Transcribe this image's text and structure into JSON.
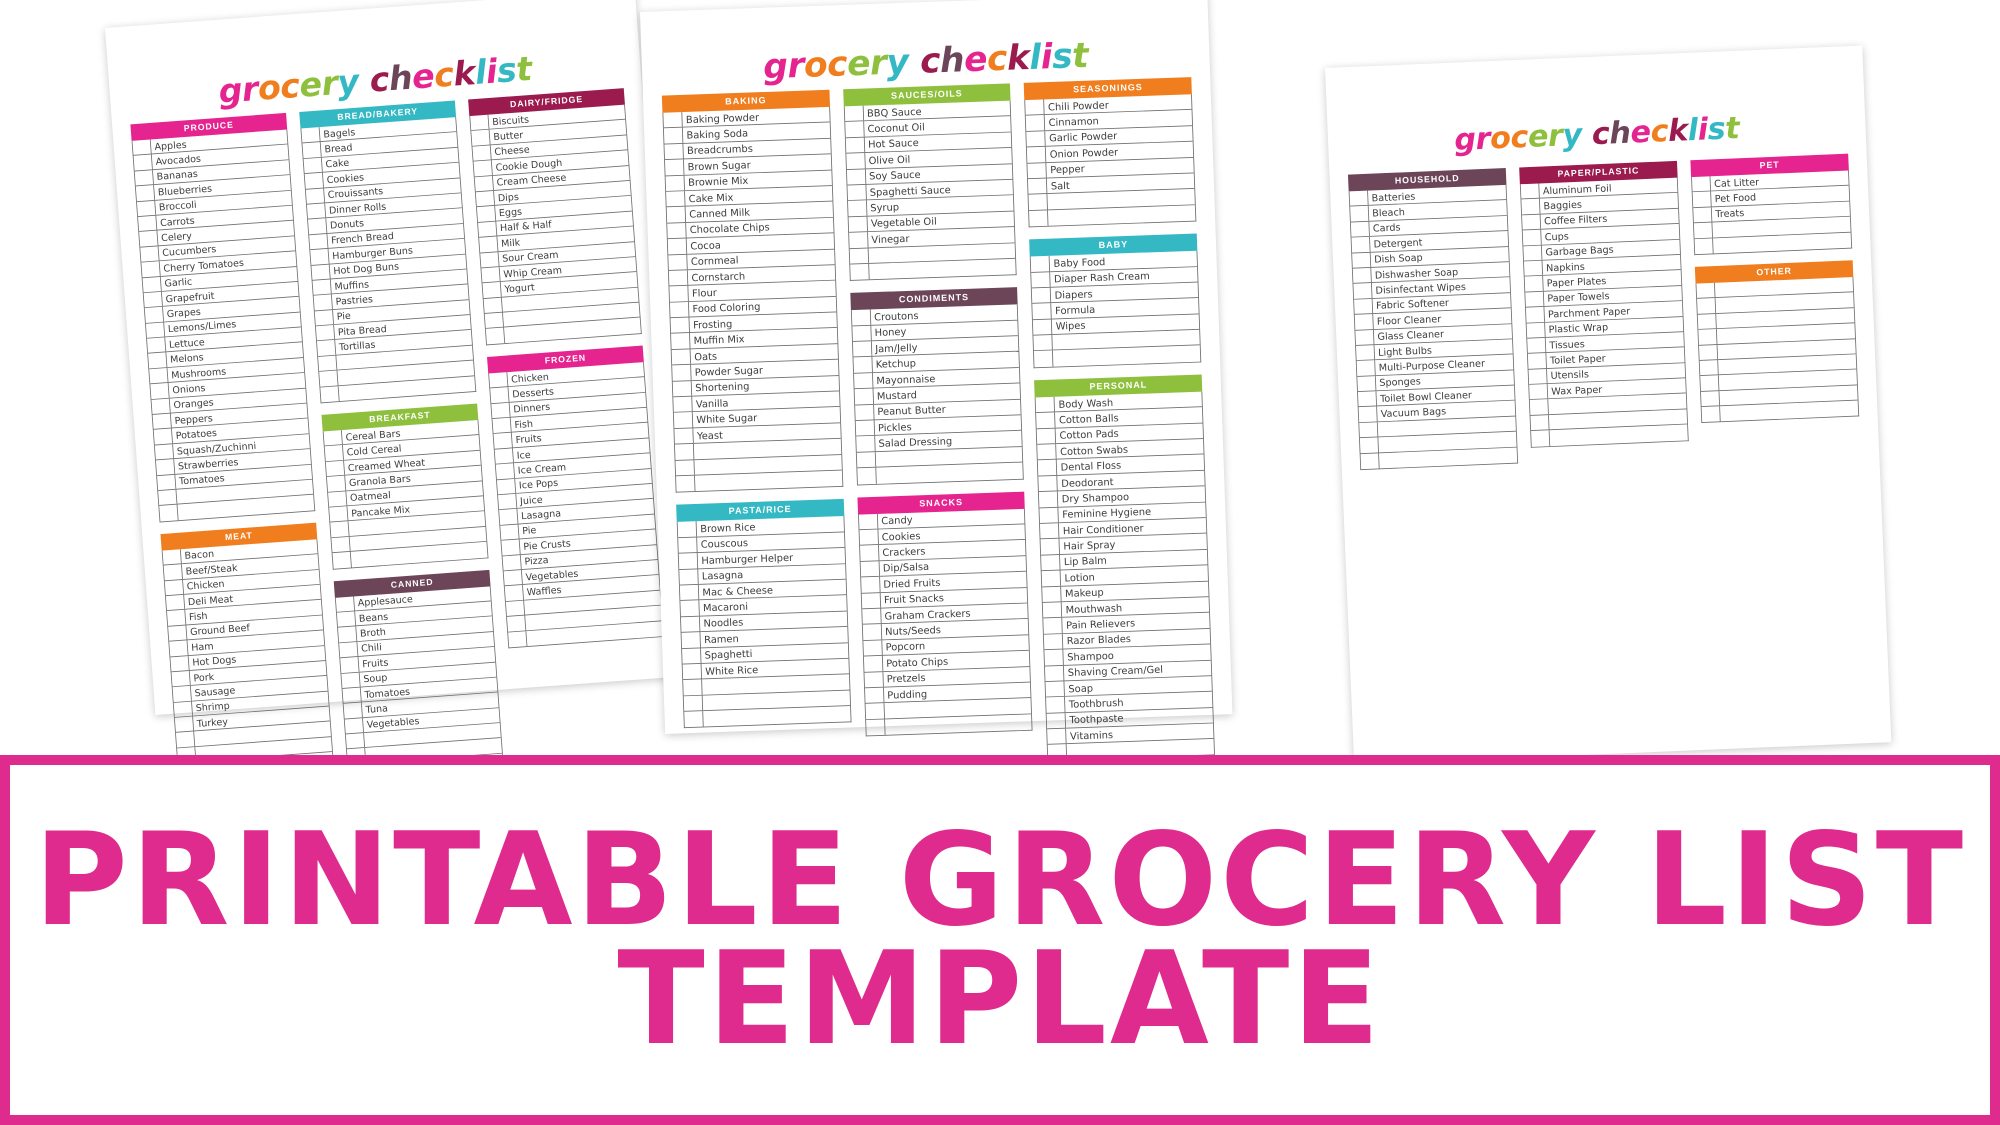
{
  "poster": {
    "banner": {
      "line1": "PRINTABLE GROCERY LIST",
      "line2": "TEMPLATE",
      "border_color": "#e02b8e",
      "text_color": "#e02b8e"
    }
  },
  "title_word1": "grocery",
  "title_word2": "checklist",
  "title_letters": [
    {
      "ch": "g",
      "color": "#e6248f"
    },
    {
      "ch": "r",
      "color": "#e6248f"
    },
    {
      "ch": "o",
      "color": "#f07d1e"
    },
    {
      "ch": "c",
      "color": "#f07d1e"
    },
    {
      "ch": "e",
      "color": "#8fc03d"
    },
    {
      "ch": "r",
      "color": "#8fc03d"
    },
    {
      "ch": "y",
      "color": "#34b9c4"
    },
    {
      "ch": " ",
      "color": "#ffffff"
    },
    {
      "ch": "c",
      "color": "#9c1b4e"
    },
    {
      "ch": "h",
      "color": "#6d4558"
    },
    {
      "ch": "e",
      "color": "#e6248f"
    },
    {
      "ch": "c",
      "color": "#f07d1e"
    },
    {
      "ch": "k",
      "color": "#9c1b4e"
    },
    {
      "ch": "l",
      "color": "#34b9c4"
    },
    {
      "ch": "i",
      "color": "#e6248f"
    },
    {
      "ch": "s",
      "color": "#34b9c4"
    },
    {
      "ch": "t",
      "color": "#8fc03d"
    }
  ],
  "colors": {
    "pink": "#e6248f",
    "teal": "#34b9c4",
    "maroon": "#9c1b4e",
    "orange": "#f07d1e",
    "green": "#8fc03d",
    "plum": "#6d4558"
  },
  "sheets": [
    {
      "id": "sheet-1",
      "columns": [
        {
          "categories": [
            {
              "name": "PRODUCE",
              "color": "#e6248f",
              "items": [
                "Apples",
                "Avocados",
                "Bananas",
                "Blueberries",
                "Broccoli",
                "Carrots",
                "Celery",
                "Cucumbers",
                "Cherry Tomatoes",
                "Garlic",
                "Grapefruit",
                "Grapes",
                "Lemons/Limes",
                "Lettuce",
                "Melons",
                "Mushrooms",
                "Onions",
                "Oranges",
                "Peppers",
                "Potatoes",
                "Squash/Zuchinni",
                "Strawberries",
                "Tomatoes"
              ],
              "blank_rows": 2
            },
            {
              "name": "MEAT",
              "color": "#f07d1e",
              "items": [
                "Bacon",
                "Beef/Steak",
                "Chicken",
                "Deli Meat",
                "Fish",
                "Ground Beef",
                "Ham",
                "Hot Dogs",
                "Pork",
                "Sausage",
                "Shrimp",
                "Turkey"
              ],
              "blank_rows": 3
            }
          ]
        },
        {
          "categories": [
            {
              "name": "BREAD/BAKERY",
              "color": "#34b9c4",
              "items": [
                "Bagels",
                "Bread",
                "Cake",
                "Cookies",
                "Crouissants",
                "Dinner Rolls",
                "Donuts",
                "French Bread",
                "Hamburger Buns",
                "Hot Dog Buns",
                "Muffins",
                "Pastries",
                "Pie",
                "Pita Bread",
                "Tortillas"
              ],
              "blank_rows": 3
            },
            {
              "name": "BREAKFAST",
              "color": "#8fc03d",
              "items": [
                "Cereal Bars",
                "Cold Cereal",
                "Creamed Wheat",
                "Granola Bars",
                "Oatmeal",
                "Pancake Mix"
              ],
              "blank_rows": 3
            },
            {
              "name": "CANNED",
              "color": "#6d4558",
              "items": [
                "Applesauce",
                "Beans",
                "Broth",
                "Chili",
                "Fruits",
                "Soup",
                "Tomatoes",
                "Tuna",
                "Vegetables"
              ],
              "blank_rows": 3
            }
          ]
        },
        {
          "categories": [
            {
              "name": "DAIRY/FRIDGE",
              "color": "#9c1b4e",
              "items": [
                "Biscuits",
                "Butter",
                "Cheese",
                "Cookie Dough",
                "Cream Cheese",
                "Dips",
                "Eggs",
                "Half & Half",
                "Milk",
                "Sour Cream",
                "Whip Cream",
                "Yogurt"
              ],
              "blank_rows": 3
            },
            {
              "name": "FROZEN",
              "color": "#e6248f",
              "items": [
                "Chicken",
                "Desserts",
                "Dinners",
                "Fish",
                "Fruits",
                "Ice",
                "Ice Cream",
                "Ice Pops",
                "Juice",
                "Lasagna",
                "Pie",
                "Pie Crusts",
                "Pizza",
                "Vegetables",
                "Waffles"
              ],
              "blank_rows": 3
            }
          ]
        }
      ]
    },
    {
      "id": "sheet-2",
      "columns": [
        {
          "categories": [
            {
              "name": "BAKING",
              "color": "#f07d1e",
              "items": [
                "Baking Powder",
                "Baking Soda",
                "Breadcrumbs",
                "Brown Sugar",
                "Brownie Mix",
                "Cake Mix",
                "Canned Milk",
                "Chocolate Chips",
                "Cocoa",
                "Cornmeal",
                "Cornstarch",
                "Flour",
                "Food Coloring",
                "Frosting",
                "Muffin Mix",
                "Oats",
                "Powder Sugar",
                "Shortening",
                "Vanilla",
                "White Sugar",
                "Yeast"
              ],
              "blank_rows": 3
            },
            {
              "name": "PASTA/RICE",
              "color": "#34b9c4",
              "items": [
                "Brown Rice",
                "Couscous",
                "Hamburger Helper",
                "Lasagna",
                "Mac & Cheese",
                "Macaroni",
                "Noodles",
                "Ramen",
                "Spaghetti",
                "White Rice"
              ],
              "blank_rows": 3
            }
          ]
        },
        {
          "categories": [
            {
              "name": "SAUCES/OILS",
              "color": "#8fc03d",
              "items": [
                "BBQ Sauce",
                "Coconut Oil",
                "Hot Sauce",
                "Olive Oil",
                "Soy Sauce",
                "Spaghetti Sauce",
                "Syrup",
                "Vegetable Oil",
                "Vinegar"
              ],
              "blank_rows": 2
            },
            {
              "name": "CONDIMENTS",
              "color": "#6d4558",
              "items": [
                "Croutons",
                "Honey",
                "Jam/Jelly",
                "Ketchup",
                "Mayonnaise",
                "Mustard",
                "Peanut Butter",
                "Pickles",
                "Salad Dressing"
              ],
              "blank_rows": 2
            },
            {
              "name": "SNACKS",
              "color": "#e6248f",
              "items": [
                "Candy",
                "Cookies",
                "Crackers",
                "Dip/Salsa",
                "Dried Fruits",
                "Fruit Snacks",
                "Graham Crackers",
                "Nuts/Seeds",
                "Popcorn",
                "Potato Chips",
                "Pretzels",
                "Pudding"
              ],
              "blank_rows": 2
            }
          ]
        },
        {
          "categories": [
            {
              "name": "SEASONINGS",
              "color": "#f07d1e",
              "items": [
                "Chili Powder",
                "Cinnamon",
                "Garlic Powder",
                "Onion Powder",
                "Pepper",
                "Salt"
              ],
              "blank_rows": 2
            },
            {
              "name": "BABY",
              "color": "#34b9c4",
              "items": [
                "Baby Food",
                "Diaper Rash Cream",
                "Diapers",
                "Formula",
                "Wipes"
              ],
              "blank_rows": 2
            },
            {
              "name": "PERSONAL",
              "color": "#8fc03d",
              "items": [
                "Body Wash",
                "Cotton Balls",
                "Cotton Pads",
                "Cotton Swabs",
                "Dental Floss",
                "Deodorant",
                "Dry Shampoo",
                "Feminine Hygiene",
                "Hair Conditioner",
                "Hair Spray",
                "Lip Balm",
                "Lotion",
                "Makeup",
                "Mouthwash",
                "Pain Relievers",
                "Razor Blades",
                "Shampoo",
                "Shaving Cream/Gel",
                "Soap",
                "Toothbrush",
                "Toothpaste",
                "Vitamins"
              ],
              "blank_rows": 2
            }
          ]
        }
      ]
    },
    {
      "id": "sheet-3",
      "columns": [
        {
          "categories": [
            {
              "name": "HOUSEHOLD",
              "color": "#6d4558",
              "items": [
                "Batteries",
                "Bleach",
                "Cards",
                "Detergent",
                "Dish Soap",
                "Dishwasher Soap",
                "Disinfectant Wipes",
                "Fabric Softener",
                "Floor Cleaner",
                "Glass Cleaner",
                "Light Bulbs",
                "Multi-Purpose Cleaner",
                "Sponges",
                "Toilet Bowl Cleaner",
                "Vacuum Bags"
              ],
              "blank_rows": 3
            }
          ]
        },
        {
          "categories": [
            {
              "name": "PAPER/PLASTIC",
              "color": "#9c1b4e",
              "items": [
                "Aluminum Foil",
                "Baggies",
                "Coffee Filters",
                "Cups",
                "Garbage Bags",
                "Napkins",
                "Paper Plates",
                "Paper Towels",
                "Parchment Paper",
                "Plastic Wrap",
                "Tissues",
                "Toilet Paper",
                "Utensils",
                "Wax Paper"
              ],
              "blank_rows": 3
            }
          ]
        },
        {
          "categories": [
            {
              "name": "PET",
              "color": "#e6248f",
              "items": [
                "Cat Litter",
                "Pet Food",
                "Treats"
              ],
              "blank_rows": 2
            },
            {
              "name": "OTHER",
              "color": "#f07d1e",
              "items": [],
              "blank_rows": 9
            }
          ]
        }
      ]
    }
  ]
}
